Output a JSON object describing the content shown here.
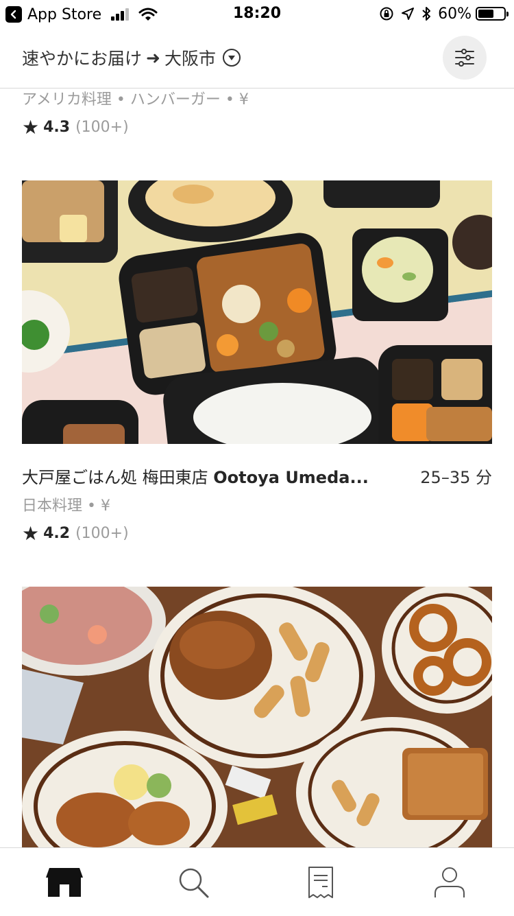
{
  "status_bar": {
    "back_app": "App Store",
    "time": "18:20",
    "battery": "60%",
    "battery_level": 0.6
  },
  "header": {
    "location_prefix": "速やかにお届け",
    "arrow": "➜",
    "city": "大阪市",
    "dropdown_icon": "chevron-down-circle-icon",
    "filter_icon": "sliders-icon"
  },
  "feed": {
    "prev_item": {
      "categories": "アメリカ料理 • ハンバーガー • ¥",
      "rating": "4.3",
      "rating_count": "(100+)"
    },
    "item1": {
      "name_ja": "大戸屋ごはん処 梅田東店 ",
      "name_en": "Ootoya Umeda...",
      "eta": "25–35 分",
      "categories": "日本料理 • ¥",
      "rating": "4.2",
      "rating_count": "(100+)",
      "photo": "bento-boxes-photo"
    },
    "item2": {
      "photo": "burger-and-sides-photo"
    }
  },
  "tab_bar": {
    "tabs": [
      "store-icon",
      "search-icon",
      "receipt-icon",
      "account-icon"
    ]
  },
  "colors": {
    "primary": "#262626",
    "muted": "#9b9b9b",
    "divider": "#d8d8d8"
  }
}
